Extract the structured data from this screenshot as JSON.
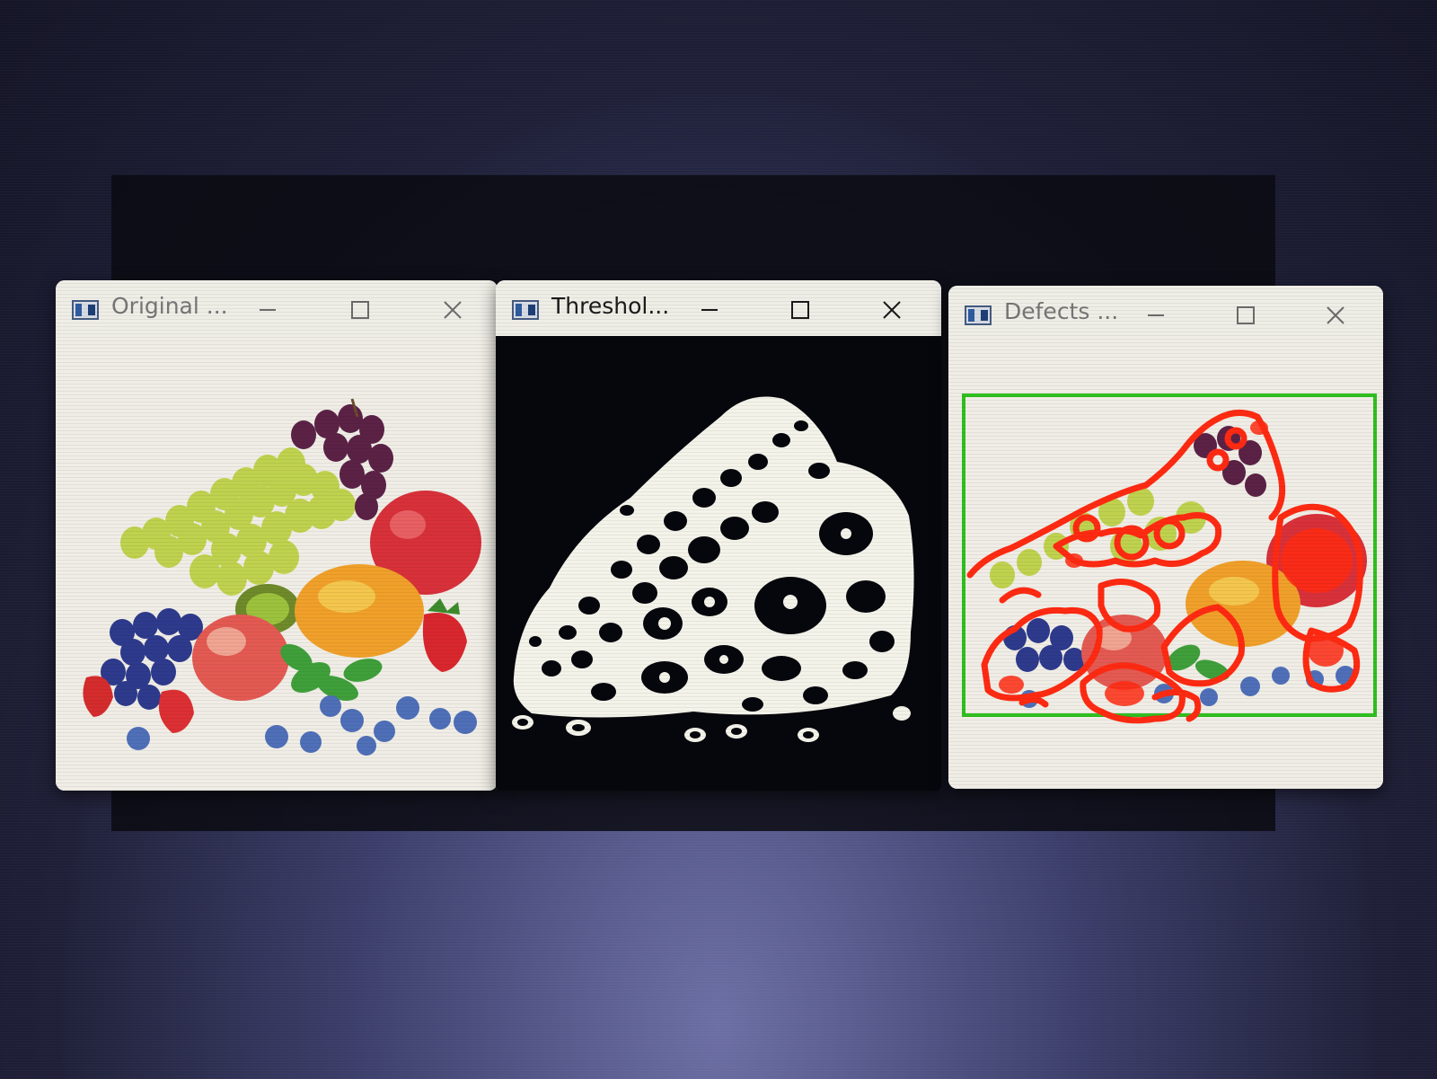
{
  "windows": [
    {
      "title": "Original ...",
      "icon": "opencv-window-icon",
      "controls": [
        "minimize-icon",
        "maximize-icon",
        "close-icon"
      ],
      "content": "color fruit photo"
    },
    {
      "title": "Threshol...",
      "icon": "opencv-window-icon",
      "controls": [
        "minimize-icon",
        "maximize-icon",
        "close-icon"
      ],
      "content": "binary threshold image"
    },
    {
      "title": "Defects ...",
      "icon": "opencv-window-icon",
      "controls": [
        "minimize-icon",
        "maximize-icon",
        "close-icon"
      ],
      "content": "fruit photo with red defect contours and green bounding box"
    }
  ],
  "colors": {
    "titlebar": "#eeede6",
    "defect_contour": "#ff2a12",
    "bounding_box": "#2fbf1f",
    "threshold_background": "#06070d",
    "threshold_foreground": "#f4f3ea"
  }
}
